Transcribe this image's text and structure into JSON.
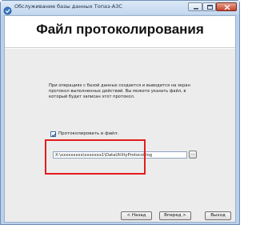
{
  "window": {
    "title": "Обслуживание базы данных Топаз-АЗС"
  },
  "header": {
    "title": "Файл протоколирования"
  },
  "main": {
    "description": "При операциях с базой данных создается и выводится на экран протокол выполненных действий. Вы можете указать файл, в который будет записан этот протокол.",
    "log_checkbox": {
      "label": "Протоколировать в файл:",
      "checked": true
    },
    "log_path": {
      "value": "X:\\xxxxxxxxx\\xxxxxxx1\\DataUtilityProtocol.log"
    },
    "browse_label": "..."
  },
  "footer": {
    "back_label": "< Назад",
    "next_label": "Вперед >",
    "exit_label": "Выход"
  },
  "colors": {
    "title_bar": "#c4d8ef",
    "highlight": "#e31d1d",
    "close_button": "#c4412a"
  }
}
